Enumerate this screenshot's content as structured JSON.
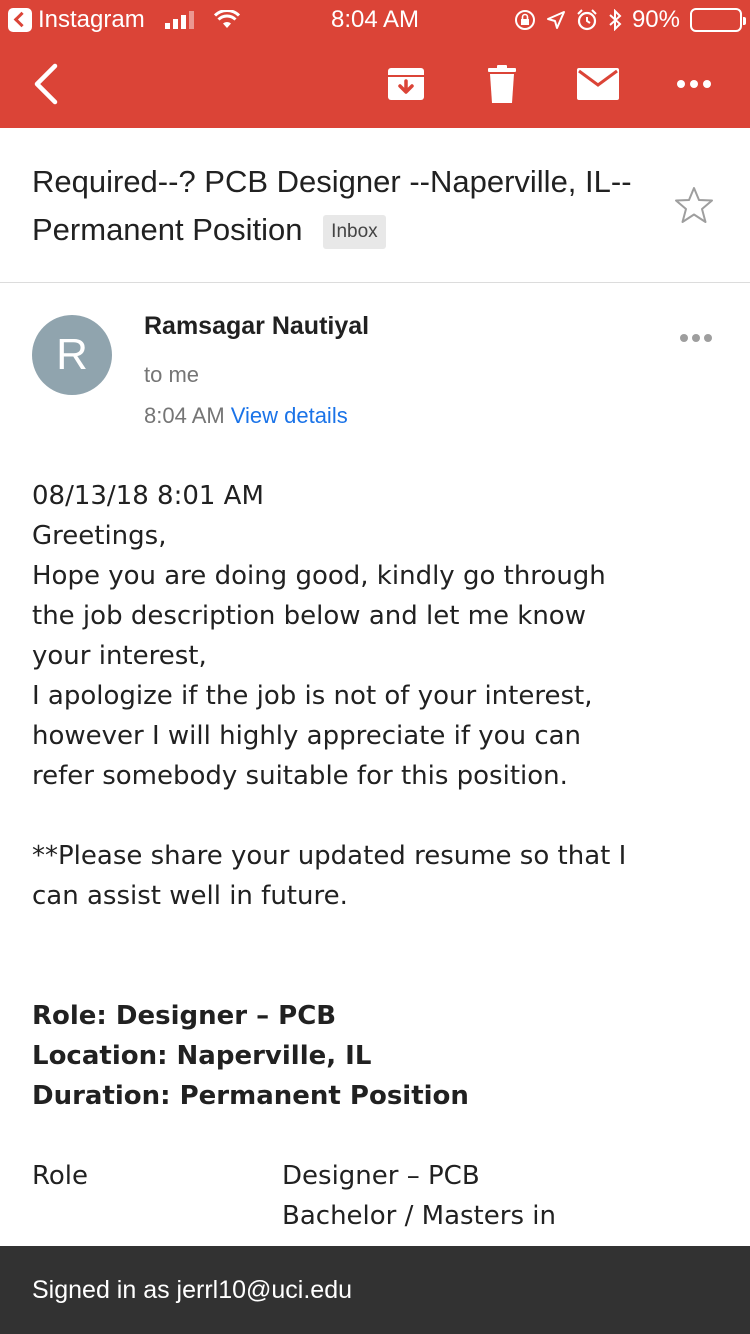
{
  "status_bar": {
    "back_app": "Instagram",
    "time": "8:04 AM",
    "battery": "90%",
    "battery_level": 0.9
  },
  "toolbar": {
    "icons": [
      "back-arrow-icon",
      "archive-icon",
      "trash-icon",
      "mail-icon",
      "more-horizontal-icon"
    ],
    "accent_color": "#db4437"
  },
  "email": {
    "subject": "Required--? PCB Designer --Naperville, IL--Permanent Position",
    "label": "Inbox",
    "sender": {
      "initial": "R",
      "name": "Ramsagar Nautiyal",
      "to": "to me",
      "time": "8:04 AM",
      "view_details": "View details"
    },
    "body": {
      "date": "08/13/18 8:01 AM",
      "greeting": "Greetings,",
      "para1": "Hope you are doing good, kindly go through\nthe job description below and let me know\nyour interest,",
      "para2": "I apologize if the job is not of your interest,\nhowever I will highly appreciate if you can\nrefer somebody suitable for this position.",
      "para3": "**Please share your updated resume so that I\ncan assist well in future.",
      "role_line": "Role: Designer – PCB",
      "location_line": "Location: Naperville, IL",
      "duration_line": "Duration: Permanent Position",
      "table": {
        "role_key": "Role",
        "role_value": "Designer – PCB",
        "edu_value": "Bachelor / Masters in"
      }
    }
  },
  "footer": {
    "signed_in": "Signed in as jerrl10@uci.edu"
  }
}
